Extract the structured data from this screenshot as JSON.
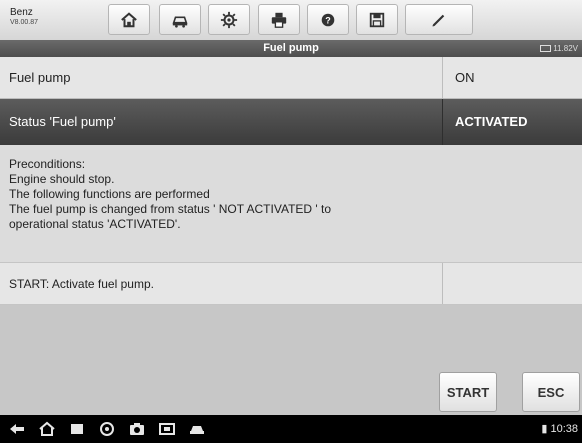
{
  "app": {
    "brand": "Benz",
    "version": "V8.00.87"
  },
  "toolbar": {
    "icons": [
      "home-icon",
      "vehicle-icon",
      "settings-icon",
      "print-icon",
      "help-icon",
      "save-icon",
      "edit-icon"
    ]
  },
  "header": {
    "title": "Fuel pump",
    "battery": "11.82V"
  },
  "rows": {
    "fuel_pump": {
      "label": "Fuel pump",
      "value": "ON"
    },
    "status": {
      "label": "Status 'Fuel pump'",
      "value": "ACTIVATED"
    },
    "preconditions": {
      "lines": [
        "Preconditions:",
        "Engine should stop.",
        "The following functions are performed",
        "The fuel pump is changed from status ' NOT ACTIVATED ' to",
        "operational status 'ACTIVATED'."
      ]
    },
    "start_instruction": {
      "label": "START: Activate fuel pump.",
      "value": ""
    }
  },
  "buttons": {
    "start": "START",
    "esc": "ESC"
  },
  "statusbar": {
    "time": "10:38"
  },
  "colors": {
    "status_row": "#4a4a4a",
    "title_bar": "#5a5a5a"
  }
}
